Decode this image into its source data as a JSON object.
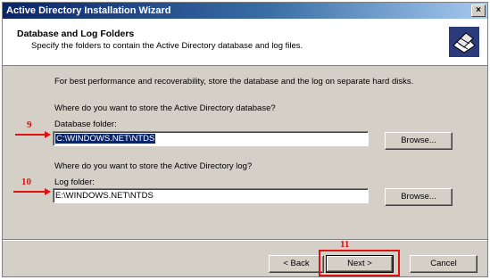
{
  "window": {
    "title": "Active Directory Installation Wizard",
    "close_glyph": "×"
  },
  "header": {
    "title": "Database and Log Folders",
    "subtitle": "Specify the folders to contain the Active Directory database and log files.",
    "icon": "database-folder-icon"
  },
  "body": {
    "intro": "For best performance and recoverability, store the database and the log on separate hard disks.",
    "db_question": "Where do you want to store the Active Directory database?",
    "db_label": "Database folder:",
    "db_value": "C:\\WINDOWS.NET\\NTDS",
    "browse_label": "Browse...",
    "log_question": "Where do you want to store the Active Directory log?",
    "log_label": "Log folder:",
    "log_value": "E:\\WINDOWS.NET\\NTDS",
    "browse_label_2": "Browse..."
  },
  "footer": {
    "back_label": "< Back",
    "next_label": "Next >",
    "cancel_label": "Cancel"
  },
  "annotations": {
    "step_db": "9",
    "step_log": "10",
    "step_next": "11",
    "color": "#e01010"
  }
}
